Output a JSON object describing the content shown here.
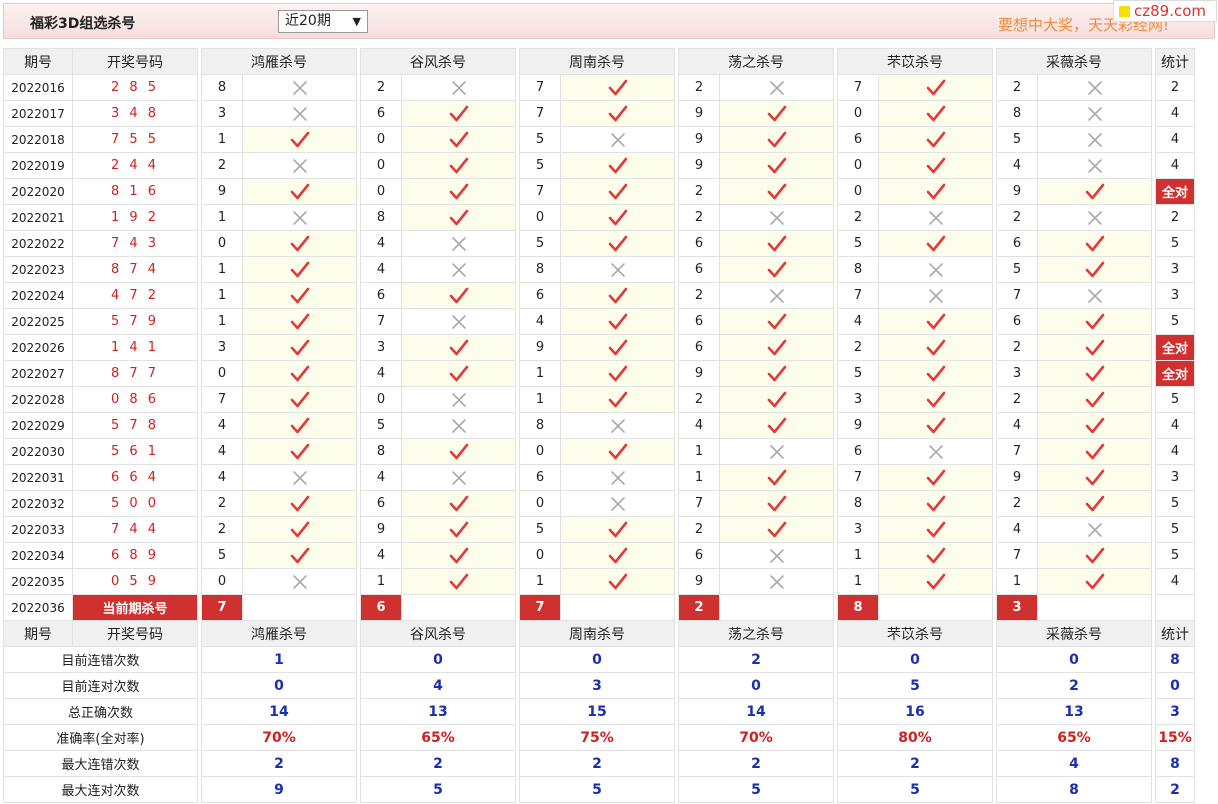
{
  "header": {
    "title": "福彩3D组选杀号",
    "select_value": "近20期",
    "slogan": "要想中大奖，天天彩经网!",
    "logo": "cz89.com"
  },
  "columns": {
    "period": "期号",
    "draw": "开奖号码",
    "experts": [
      "鸿雁杀号",
      "谷风杀号",
      "周南杀号",
      "荡之杀号",
      "芣苡杀号",
      "采薇杀号"
    ],
    "stat": "统计"
  },
  "all_correct_label": "全对",
  "rows": [
    {
      "period": "2022016",
      "draw": "2 8 5",
      "kills": [
        8,
        2,
        7,
        2,
        7,
        2
      ],
      "ok": [
        false,
        false,
        true,
        false,
        true,
        false
      ],
      "stat": "2"
    },
    {
      "period": "2022017",
      "draw": "3 4 8",
      "kills": [
        3,
        6,
        7,
        9,
        0,
        8
      ],
      "ok": [
        false,
        true,
        true,
        true,
        true,
        false
      ],
      "stat": "4"
    },
    {
      "period": "2022018",
      "draw": "7 5 5",
      "kills": [
        1,
        0,
        5,
        9,
        6,
        5
      ],
      "ok": [
        true,
        true,
        false,
        true,
        true,
        false
      ],
      "stat": "4"
    },
    {
      "period": "2022019",
      "draw": "2 4 4",
      "kills": [
        2,
        0,
        5,
        9,
        0,
        4
      ],
      "ok": [
        false,
        true,
        true,
        true,
        true,
        false
      ],
      "stat": "4"
    },
    {
      "period": "2022020",
      "draw": "8 1 6",
      "kills": [
        9,
        0,
        7,
        2,
        0,
        9
      ],
      "ok": [
        true,
        true,
        true,
        true,
        true,
        true
      ],
      "stat": "全对"
    },
    {
      "period": "2022021",
      "draw": "1 9 2",
      "kills": [
        1,
        8,
        0,
        2,
        2,
        2
      ],
      "ok": [
        false,
        true,
        true,
        false,
        false,
        false
      ],
      "stat": "2"
    },
    {
      "period": "2022022",
      "draw": "7 4 3",
      "kills": [
        0,
        4,
        5,
        6,
        5,
        6
      ],
      "ok": [
        true,
        false,
        true,
        true,
        true,
        true
      ],
      "stat": "5"
    },
    {
      "period": "2022023",
      "draw": "8 7 4",
      "kills": [
        1,
        4,
        8,
        6,
        8,
        5
      ],
      "ok": [
        true,
        false,
        false,
        true,
        false,
        true
      ],
      "stat": "3"
    },
    {
      "period": "2022024",
      "draw": "4 7 2",
      "kills": [
        1,
        6,
        6,
        2,
        7,
        7
      ],
      "ok": [
        true,
        true,
        true,
        false,
        false,
        false
      ],
      "stat": "3"
    },
    {
      "period": "2022025",
      "draw": "5 7 9",
      "kills": [
        1,
        7,
        4,
        6,
        4,
        6
      ],
      "ok": [
        true,
        false,
        true,
        true,
        true,
        true
      ],
      "stat": "5"
    },
    {
      "period": "2022026",
      "draw": "1 4 1",
      "kills": [
        3,
        3,
        9,
        6,
        2,
        2
      ],
      "ok": [
        true,
        true,
        true,
        true,
        true,
        true
      ],
      "stat": "全对"
    },
    {
      "period": "2022027",
      "draw": "8 7 7",
      "kills": [
        0,
        4,
        1,
        9,
        5,
        3
      ],
      "ok": [
        true,
        true,
        true,
        true,
        true,
        true
      ],
      "stat": "全对"
    },
    {
      "period": "2022028",
      "draw": "0 8 6",
      "kills": [
        7,
        0,
        1,
        2,
        3,
        2
      ],
      "ok": [
        true,
        false,
        true,
        true,
        true,
        true
      ],
      "stat": "5"
    },
    {
      "period": "2022029",
      "draw": "5 7 8",
      "kills": [
        4,
        5,
        8,
        4,
        9,
        4
      ],
      "ok": [
        true,
        false,
        false,
        true,
        true,
        true
      ],
      "stat": "4"
    },
    {
      "period": "2022030",
      "draw": "5 6 1",
      "kills": [
        4,
        8,
        0,
        1,
        6,
        7
      ],
      "ok": [
        true,
        true,
        true,
        false,
        false,
        true
      ],
      "stat": "4"
    },
    {
      "period": "2022031",
      "draw": "6 6 4",
      "kills": [
        4,
        4,
        6,
        1,
        7,
        9
      ],
      "ok": [
        false,
        false,
        false,
        true,
        true,
        true
      ],
      "stat": "3"
    },
    {
      "period": "2022032",
      "draw": "5 0 0",
      "kills": [
        2,
        6,
        0,
        7,
        8,
        2
      ],
      "ok": [
        true,
        true,
        false,
        true,
        true,
        true
      ],
      "stat": "5"
    },
    {
      "period": "2022033",
      "draw": "7 4 4",
      "kills": [
        2,
        9,
        5,
        2,
        3,
        4
      ],
      "ok": [
        true,
        true,
        true,
        true,
        true,
        false
      ],
      "stat": "5"
    },
    {
      "period": "2022034",
      "draw": "6 8 9",
      "kills": [
        5,
        4,
        0,
        6,
        1,
        7
      ],
      "ok": [
        true,
        true,
        true,
        false,
        true,
        true
      ],
      "stat": "5"
    },
    {
      "period": "2022035",
      "draw": "0 5 9",
      "kills": [
        0,
        1,
        1,
        9,
        1,
        1
      ],
      "ok": [
        false,
        true,
        true,
        false,
        true,
        true
      ],
      "stat": "4"
    }
  ],
  "current": {
    "period": "2022036",
    "label": "当前期杀号",
    "kills": [
      "7",
      "6",
      "7",
      "2",
      "8",
      "3"
    ]
  },
  "stats": [
    {
      "label": "目前连错次数",
      "values": [
        "1",
        "0",
        "0",
        "2",
        "0",
        "0"
      ],
      "total": "8",
      "red": false
    },
    {
      "label": "目前连对次数",
      "values": [
        "0",
        "4",
        "3",
        "0",
        "5",
        "2"
      ],
      "total": "0",
      "red": false
    },
    {
      "label": "总正确次数",
      "values": [
        "14",
        "13",
        "15",
        "14",
        "16",
        "13"
      ],
      "total": "3",
      "red": false
    },
    {
      "label": "准确率(全对率)",
      "values": [
        "70%",
        "65%",
        "75%",
        "70%",
        "80%",
        "65%"
      ],
      "total": "15%",
      "red": true
    },
    {
      "label": "最大连错次数",
      "values": [
        "2",
        "2",
        "2",
        "2",
        "2",
        "4"
      ],
      "total": "8",
      "red": false
    },
    {
      "label": "最大连对次数",
      "values": [
        "9",
        "5",
        "5",
        "5",
        "5",
        "8"
      ],
      "total": "2",
      "red": false
    }
  ],
  "colors": {
    "check": "#e23a3a",
    "cross": "#aaaaaa",
    "current_bg": "#cf3030",
    "ok_bg": "#fdfdeb",
    "stat_blue": "#1a2fb0",
    "stat_red": "#d02020"
  }
}
